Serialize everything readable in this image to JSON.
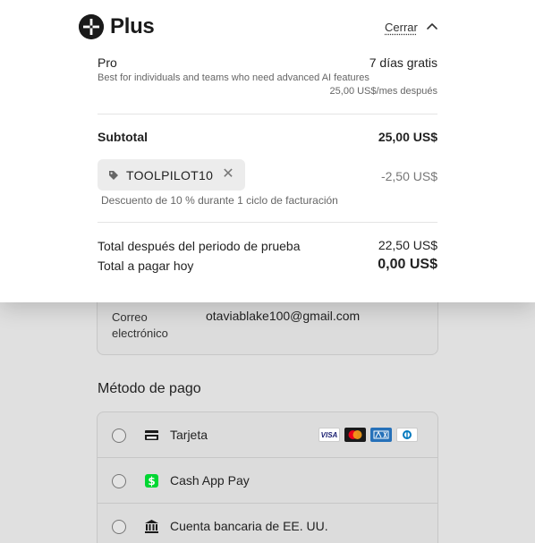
{
  "header": {
    "brand": "Plus",
    "close_label": "Cerrar"
  },
  "plan": {
    "name": "Pro",
    "trial": "7 días gratis",
    "description": "Best for individuals and teams who need advanced AI features",
    "price_after": "25,00 US$/mes después"
  },
  "summary": {
    "subtotal_label": "Subtotal",
    "subtotal_value": "25,00 US$",
    "coupon_code": "TOOLPILOT10",
    "discount_value": "-2,50 US$",
    "discount_description": "Descuento de 10 % durante 1 ciclo de facturación",
    "after_trial_label": "Total después del periodo de prueba",
    "after_trial_value": "22,50 US$",
    "today_label": "Total a pagar hoy",
    "today_value": "0,00 US$"
  },
  "contact": {
    "email_label": "Correo electrónico",
    "email_value": "otaviablake100@gmail.com"
  },
  "payment": {
    "title": "Método de pago",
    "options": [
      {
        "label": "Tarjeta",
        "icon": "credit-card-icon"
      },
      {
        "label": "Cash App Pay",
        "icon": "cash-app-icon"
      },
      {
        "label": "Cuenta bancaria de EE. UU.",
        "icon": "bank-icon"
      }
    ],
    "card_brands": [
      "VISA",
      "Mastercard",
      "AMEX",
      "Diners Club"
    ]
  },
  "colors": {
    "cash_app_green": "#00d632",
    "amex_blue": "#2671b9"
  }
}
